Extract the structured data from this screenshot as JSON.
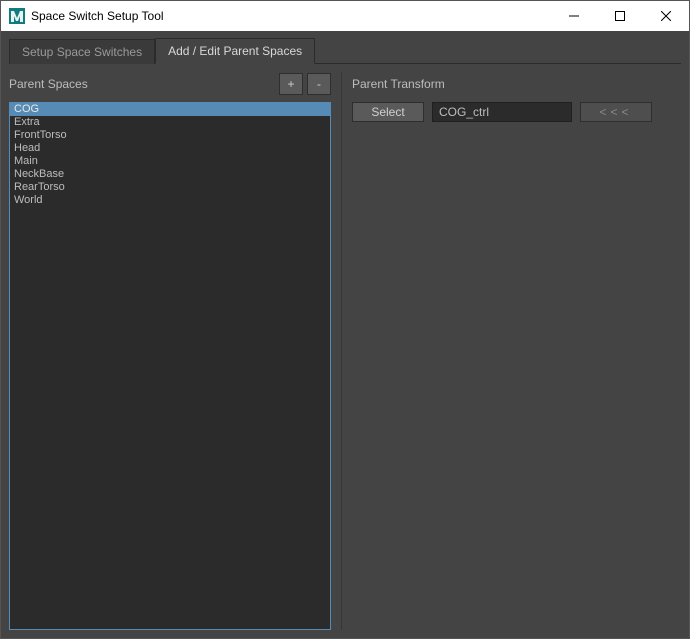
{
  "window": {
    "title": "Space Switch Setup Tool"
  },
  "tabs": {
    "setup": "Setup Space Switches",
    "edit": "Add / Edit Parent Spaces",
    "active_index": 1
  },
  "left_panel": {
    "title": "Parent Spaces",
    "add_button": "+",
    "remove_button": "-",
    "selected_index": 0,
    "items": [
      "COG",
      "Extra",
      "FrontTorso",
      "Head",
      "Main",
      "NeckBase",
      "RearTorso",
      "World"
    ]
  },
  "right_panel": {
    "title": "Parent Transform",
    "select_button": "Select",
    "transform_value": "COG_ctrl",
    "arrows_button": "<<<"
  }
}
